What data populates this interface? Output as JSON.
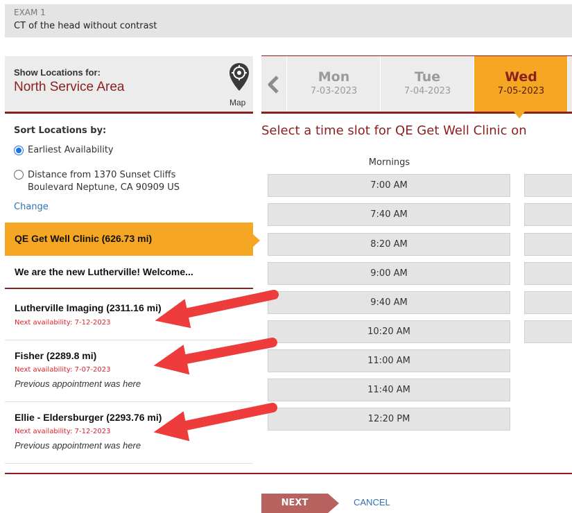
{
  "exam": {
    "label": "EXAM 1",
    "name": "CT of the head without contrast"
  },
  "locations_panel": {
    "label": "Show Locations for:",
    "value": "North Service Area",
    "map_label": "Map"
  },
  "days": [
    {
      "name": "Mon",
      "date": "7-03-2023",
      "selected": false
    },
    {
      "name": "Tue",
      "date": "7-04-2023",
      "selected": false
    },
    {
      "name": "Wed",
      "date": "7-05-2023",
      "selected": true
    }
  ],
  "sort": {
    "label": "Sort Locations by:",
    "options": [
      {
        "label": "Earliest Availability",
        "checked": true
      },
      {
        "label_line1": "Distance from 1370 Sunset Cliffs",
        "label_line2": "Boulevard Neptune, CA 90909 US",
        "checked": false
      }
    ],
    "change_label": "Change"
  },
  "locations": [
    {
      "name": "QE Get Well Clinic (626.73 mi)",
      "selected": true
    },
    {
      "name": "We are the new Lutherville! Welcome..."
    },
    {
      "name": "Lutherville Imaging (2311.16 mi)",
      "availability": "Next availability: 7-12-2023"
    },
    {
      "name": "Fisher (2289.8 mi)",
      "availability": "Next availability: 7-07-2023",
      "note": "Previous appointment was here"
    },
    {
      "name": "Ellie - Eldersburger (2293.76 mi)",
      "availability": "Next availability: 7-12-2023",
      "note": "Previous appointment was here"
    }
  ],
  "slots": {
    "title": "Select a time slot for QE Get Well Clinic on",
    "period": "Mornings",
    "times": [
      "7:00 AM",
      "7:40 AM",
      "8:20 AM",
      "9:00 AM",
      "9:40 AM",
      "10:20 AM",
      "11:00 AM",
      "11:40 AM",
      "12:20 PM"
    ]
  },
  "actions": {
    "next": "NEXT",
    "cancel": "CANCEL"
  },
  "colors": {
    "accent": "#f5a623",
    "brand": "#8a1f1f",
    "link": "#2f6fb6",
    "alert": "#e0202a",
    "annotation_arrow": "#ee3b3b"
  }
}
